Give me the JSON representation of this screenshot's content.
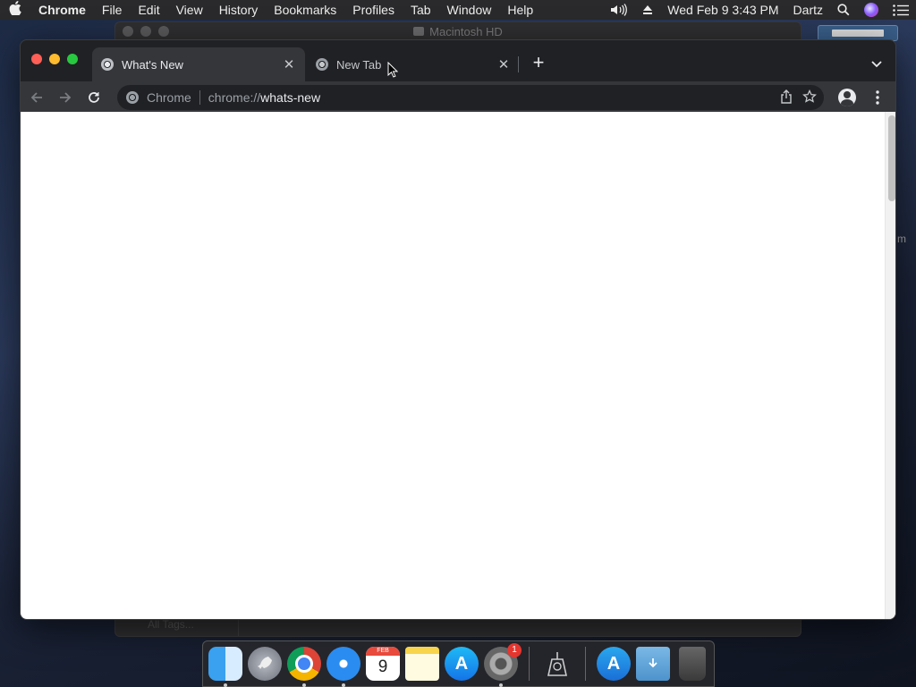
{
  "menubar": {
    "app_name": "Chrome",
    "items": [
      "File",
      "Edit",
      "View",
      "History",
      "Bookmarks",
      "Profiles",
      "Tab",
      "Window",
      "Help"
    ],
    "datetime": "Wed Feb 9  3:43 PM",
    "user": "Dartz"
  },
  "background_window": {
    "title": "Macintosh HD",
    "sidebar_footer": "All Tags..."
  },
  "desktop": {
    "edge_label": "m"
  },
  "chrome": {
    "tabs": [
      {
        "label": "What's New",
        "active": true
      },
      {
        "label": "New Tab",
        "active": false
      }
    ],
    "new_tab_symbol": "+",
    "omnibox": {
      "chip": "Chrome",
      "url_scheme": "chrome://",
      "url_path": "whats-new"
    }
  },
  "dock": {
    "calendar_month": "FEB",
    "calendar_day": "9",
    "sysprefs_badge": "1",
    "apps": [
      "Finder",
      "Launchpad",
      "Google Chrome",
      "Safari",
      "Calendar",
      "Notes",
      "App Store",
      "System Preferences",
      "Screenshot",
      "Applications",
      "Downloads",
      "Trash"
    ]
  },
  "colors": {
    "accent_close": "#ff5f57",
    "accent_minimize": "#febc2e",
    "accent_maximize": "#28c840",
    "chrome_frame": "#202124",
    "chrome_toolbar": "#35363a"
  }
}
